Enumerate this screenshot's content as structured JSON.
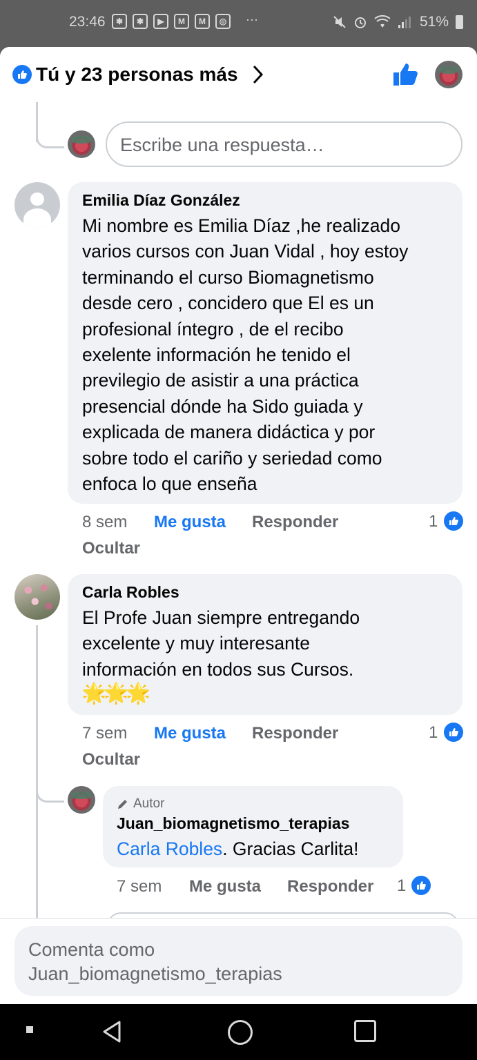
{
  "status_bar": {
    "time": "23:46",
    "notification_icons": [
      "grid-app-icon",
      "grid-app-icon",
      "youtube-icon",
      "gmail-icon",
      "gmail-icon",
      "instagram-icon"
    ],
    "dots": "···",
    "battery": "51%"
  },
  "header": {
    "reactions_summary": "Tú y 23 personas más"
  },
  "reply_box_top": {
    "placeholder": "Escribe una respuesta…"
  },
  "comments": [
    {
      "author": "Emilia Díaz González",
      "text": "Mi nombre es Emilia Díaz ,he realizado\nvarios cursos con Juan Vidal , hoy estoy\nterminando el curso Biomagnetismo\ndesde cero , concidero  que  El es un\nprofesional íntegro , de  el recibo\nexelente información he tenido el\nprevilegio de asistir a una práctica\npresencial dónde ha Sido guiada y\nexplicada  de manera didáctica y por\nsobre todo el cariño y seriedad como\nenfoca lo que enseña",
      "time": "8 sem",
      "like": "Me gusta",
      "reply": "Responder",
      "hide": "Ocultar",
      "like_count": "1"
    },
    {
      "author": "Carla Robles",
      "text": "El Profe Juan siempre entregando\nexcelente y muy interesante\ninformación en todos sus Cursos.",
      "emoji": "🌟🌟🌟",
      "time": "7 sem",
      "like": "Me gusta",
      "reply": "Responder",
      "hide": "Ocultar",
      "like_count": "1"
    }
  ],
  "reply": {
    "badge": "Autor",
    "author": "Juan_biomagnetismo_terapias",
    "mention": "Carla Robles",
    "text": ". Gracias Carlita!",
    "time": "7 sem",
    "like": "Me gusta",
    "reply": "Responder",
    "like_count": "1"
  },
  "footer": {
    "placeholder": "Comenta como\nJuan_biomagnetismo_terapias"
  },
  "colors": {
    "accent": "#1877f2",
    "bubble": "#f0f2f5",
    "secondary_text": "#65676b"
  }
}
